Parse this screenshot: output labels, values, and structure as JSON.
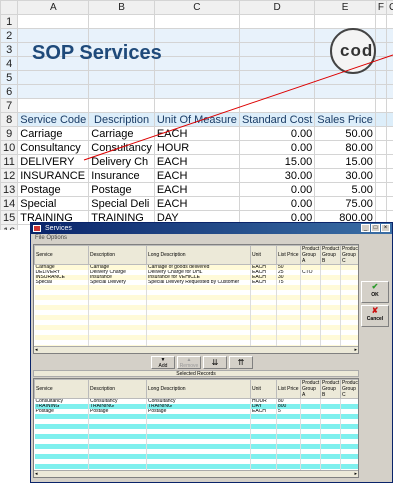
{
  "sheet": {
    "col_headers": [
      "A",
      "B",
      "C",
      "D",
      "E",
      "F",
      "G"
    ],
    "row_numbers": [
      "1",
      "2",
      "3",
      "4",
      "5",
      "6",
      "7",
      "8",
      "9",
      "10",
      "11",
      "12",
      "13",
      "14",
      "15",
      "16"
    ],
    "title": "SOP Services",
    "logo_text": "codus",
    "headers": [
      "Service Code",
      "Description",
      "Unit Of Measure",
      "Standard Cost",
      "Sales Price"
    ],
    "rows": [
      [
        "Carriage",
        "Carriage",
        "EACH",
        "0.00",
        "50.00"
      ],
      [
        "Consultancy",
        "Consultancy",
        "HOUR",
        "0.00",
        "80.00"
      ],
      [
        "DELIVERY",
        "Delivery Ch",
        "EACH",
        "15.00",
        "15.00"
      ],
      [
        "INSURANCE",
        "Insurance",
        "EACH",
        "30.00",
        "30.00"
      ],
      [
        "Postage",
        "Postage",
        "EACH",
        "0.00",
        "5.00"
      ],
      [
        "Special",
        "Special Deli",
        "EACH",
        "0.00",
        "75.00"
      ],
      [
        "TRAINING",
        "TRAINING",
        "DAY",
        "0.00",
        "800.00"
      ]
    ],
    "accent": "#1f4a7a",
    "line_color": "#dd0000"
  },
  "dialog": {
    "title": "Services",
    "menu": "File   Options",
    "top_columns": [
      "Service",
      "Description",
      "Long Description",
      "Unit",
      "List Price",
      "Product Group A",
      "Product Group B",
      "Product Group C"
    ],
    "top_rows": [
      [
        "Carriage",
        "Carriage",
        "Carriage of goods delivered",
        "EACH",
        "50",
        "",
        "",
        ""
      ],
      [
        "DELIVERY",
        "Delivery Charge",
        "Delivery Charge for DHL",
        "EACH",
        "25",
        "CTO",
        "",
        ""
      ],
      [
        "INSURANCE",
        "Insurance",
        "Insurance for VEHICLE",
        "EACH",
        "30",
        "",
        "",
        ""
      ],
      [
        "Special",
        "Special Delivery",
        "Special Delivery Requested by Customer",
        "EACH",
        "75",
        "",
        "",
        ""
      ]
    ],
    "add_label": "Add",
    "remove_label": "Remove",
    "selected_label": "Selected Records",
    "bottom_columns": [
      "Service",
      "Description",
      "Long Description",
      "Unit",
      "List Price",
      "Product Group A",
      "Product Group B",
      "Product Group C"
    ],
    "bottom_rows": [
      [
        "Consultancy",
        "Consultancy",
        "Consultancy",
        "HOUR",
        "80",
        "",
        "",
        ""
      ],
      [
        "TRAINING",
        "TRAINING",
        "TRAINING",
        "DAY",
        "800",
        "",
        "",
        ""
      ],
      [
        "Postage",
        "Postage",
        "Postage",
        "EACH",
        "5",
        "",
        "",
        ""
      ]
    ],
    "ok_label": "OK",
    "cancel_label": "Cancel",
    "win_buttons": [
      "_",
      "□",
      "×"
    ],
    "arrows": {
      "down": "▼",
      "up": "▲",
      "double_down": "⇊",
      "double_up": "⇈",
      "left": "◂",
      "right": "▸"
    },
    "icons": {
      "ok": "✔",
      "cancel": "✘"
    }
  }
}
